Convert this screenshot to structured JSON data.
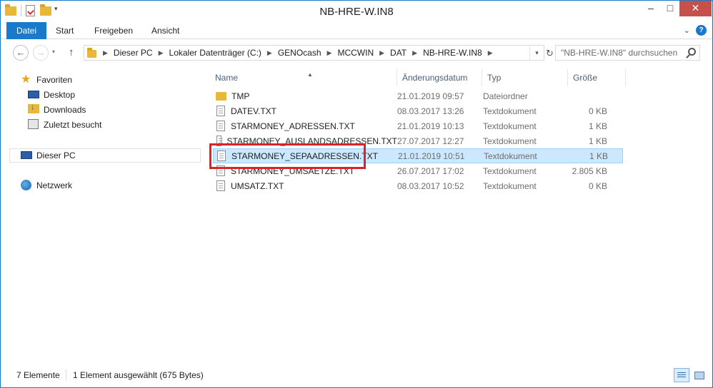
{
  "window": {
    "title": "NB-HRE-W.IN8"
  },
  "ribbon": {
    "tabs": [
      {
        "label": "Datei"
      },
      {
        "label": "Start"
      },
      {
        "label": "Freigeben"
      },
      {
        "label": "Ansicht"
      }
    ]
  },
  "address": {
    "breadcrumbs": [
      "Dieser PC",
      "Lokaler Datenträger (C:)",
      "GENOcash",
      "MCCWIN",
      "DAT",
      "NB-HRE-W.IN8"
    ]
  },
  "search": {
    "placeholder": "\"NB-HRE-W.IN8\" durchsuchen"
  },
  "sidebar": {
    "favorites_label": "Favoriten",
    "favorites": [
      {
        "label": "Desktop",
        "icon": "desktop-icon"
      },
      {
        "label": "Downloads",
        "icon": "downloads-icon"
      },
      {
        "label": "Zuletzt besucht",
        "icon": "recent-places-icon"
      }
    ],
    "this_pc": "Dieser PC",
    "network": "Netzwerk"
  },
  "columns": {
    "name": "Name",
    "date": "Änderungsdatum",
    "type": "Typ",
    "size": "Größe"
  },
  "files": [
    {
      "name": "TMP",
      "date": "21.01.2019 09:57",
      "type": "Dateiordner",
      "size": "",
      "icon": "folder-icon"
    },
    {
      "name": "DATEV.TXT",
      "date": "08.03.2017 13:26",
      "type": "Textdokument",
      "size": "0 KB",
      "icon": "text-file-icon"
    },
    {
      "name": "STARMONEY_ADRESSEN.TXT",
      "date": "21.01.2019 10:13",
      "type": "Textdokument",
      "size": "1 KB",
      "icon": "text-file-icon"
    },
    {
      "name": "STARMONEY_AUSLANDSADRESSEN.TXT",
      "date": "27.07.2017 12:27",
      "type": "Textdokument",
      "size": "1 KB",
      "icon": "text-file-icon"
    },
    {
      "name": "STARMONEY_SEPAADRESSEN.TXT",
      "date": "21.01.2019 10:51",
      "type": "Textdokument",
      "size": "1 KB",
      "icon": "text-file-icon",
      "selected": true
    },
    {
      "name": "STARMONEY_UMSAETZE.TXT",
      "date": "26.07.2017 17:02",
      "type": "Textdokument",
      "size": "2.805 KB",
      "icon": "text-file-icon"
    },
    {
      "name": "UMSATZ.TXT",
      "date": "08.03.2017 10:52",
      "type": "Textdokument",
      "size": "0 KB",
      "icon": "text-file-icon"
    }
  ],
  "status": {
    "count": "7 Elemente",
    "selection": "1 Element ausgewählt (675 Bytes)"
  },
  "colors": {
    "accent": "#1979ca",
    "selection": "#cce8ff",
    "highlight_box": "#d9242a",
    "close_button": "#c7514a"
  }
}
